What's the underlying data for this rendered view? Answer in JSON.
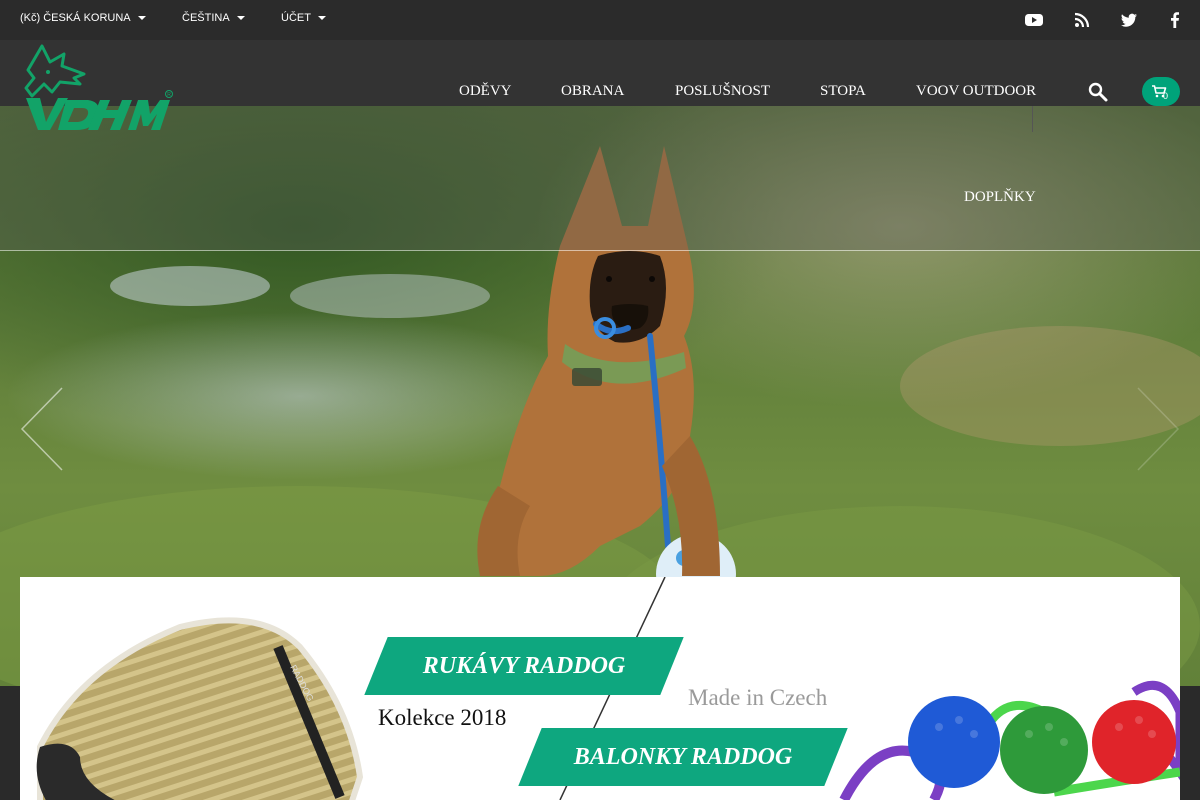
{
  "topbar": {
    "currency": "(Kč) ČESKÁ KORUNA",
    "language": "ČEŠTINA",
    "account": "ÚČET",
    "social_icons": [
      "youtube-icon",
      "rss-icon",
      "twitter-icon",
      "facebook-icon"
    ]
  },
  "nav": {
    "items": [
      "ODĚVY",
      "OBRANA",
      "POSLUŠNOST",
      "STOPA",
      "VOOV OUTDOOR"
    ],
    "second_row": [
      "DOPLŇKY"
    ],
    "cart_count": "0"
  },
  "promo": {
    "tag1": "RUKÁVY RADDOG",
    "collection": "Kolekce 2018",
    "made_in": "Made in Czech",
    "tag2": "BALONKY RADDOG",
    "sleeve_print": "RADDOG"
  },
  "colors": {
    "accent": "#0ea77f",
    "topbar_bg": "#2b2b2b",
    "header_bg": "#333333"
  }
}
